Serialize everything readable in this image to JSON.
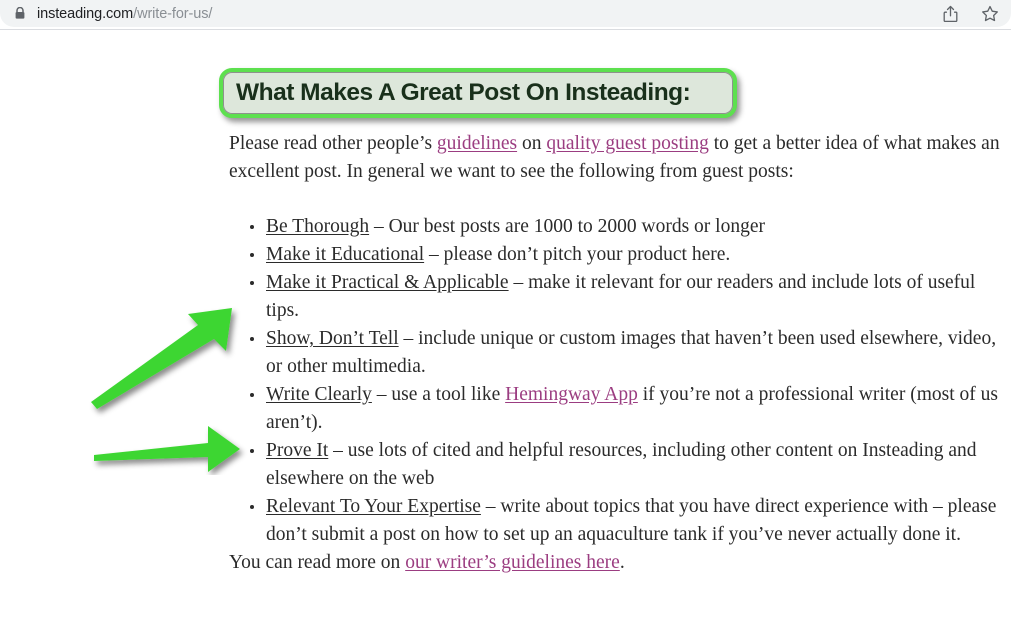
{
  "browser": {
    "lock_icon": "lock-icon",
    "url_domain": "insteading.com",
    "url_path": "/write-for-us/",
    "share_icon": "share-icon",
    "bookmark_icon": "star-icon"
  },
  "colors": {
    "accent_green": "#5de04f",
    "arrow_green": "#3ed633",
    "title_fill": "#dde7db",
    "title_text": "#19301b",
    "link": "#9b3d81",
    "body_text": "#2b2b2b",
    "toolbar_bg": "#f1f3f4"
  },
  "page": {
    "title": "What Makes A Great Post On Insteading:",
    "intro": {
      "before_link1": "Please read other people’s ",
      "link1": "guidelines",
      "between_links": " on ",
      "link2": "quality guest posting",
      "after_link2": " to get a better idea of what makes an excellent post. In general we want to see the following from guest posts:"
    },
    "bullets": [
      {
        "lead": "Be Thorough",
        "text": " – Our best posts are 1000 to 2000 words or longer"
      },
      {
        "lead": "Make it Educational",
        "text": " – please don’t pitch your product here."
      },
      {
        "lead": "Make it Practical & Applicable",
        "text": " – make it relevant for our readers and include lots of useful tips."
      },
      {
        "lead": "Show, Don’t Tell",
        "text": " – include unique or custom images that haven’t been used elsewhere, video, or other multimedia."
      },
      {
        "lead": "Write Clearly",
        "text_before_link": " – use a tool like ",
        "link": "Hemingway App",
        "text_after_link": " if you’re not a professional writer (most of us aren’t)."
      },
      {
        "lead": "Prove It",
        "text": " – use lots of cited and helpful resources, including other content on Insteading and elsewhere on the web"
      },
      {
        "lead": "Relevant To Your Expertise",
        "text": " – write about topics that you have direct experience with – please don’t submit a post on how to set up an aquaculture tank if you’ve never actually done it."
      }
    ],
    "outro": {
      "before_link": "You can read more on ",
      "link": "our writer’s guidelines here",
      "after_link": "."
    }
  },
  "annotations": {
    "arrow_diagonal": "arrow-up-right-icon",
    "arrow_horizontal": "arrow-right-icon"
  }
}
